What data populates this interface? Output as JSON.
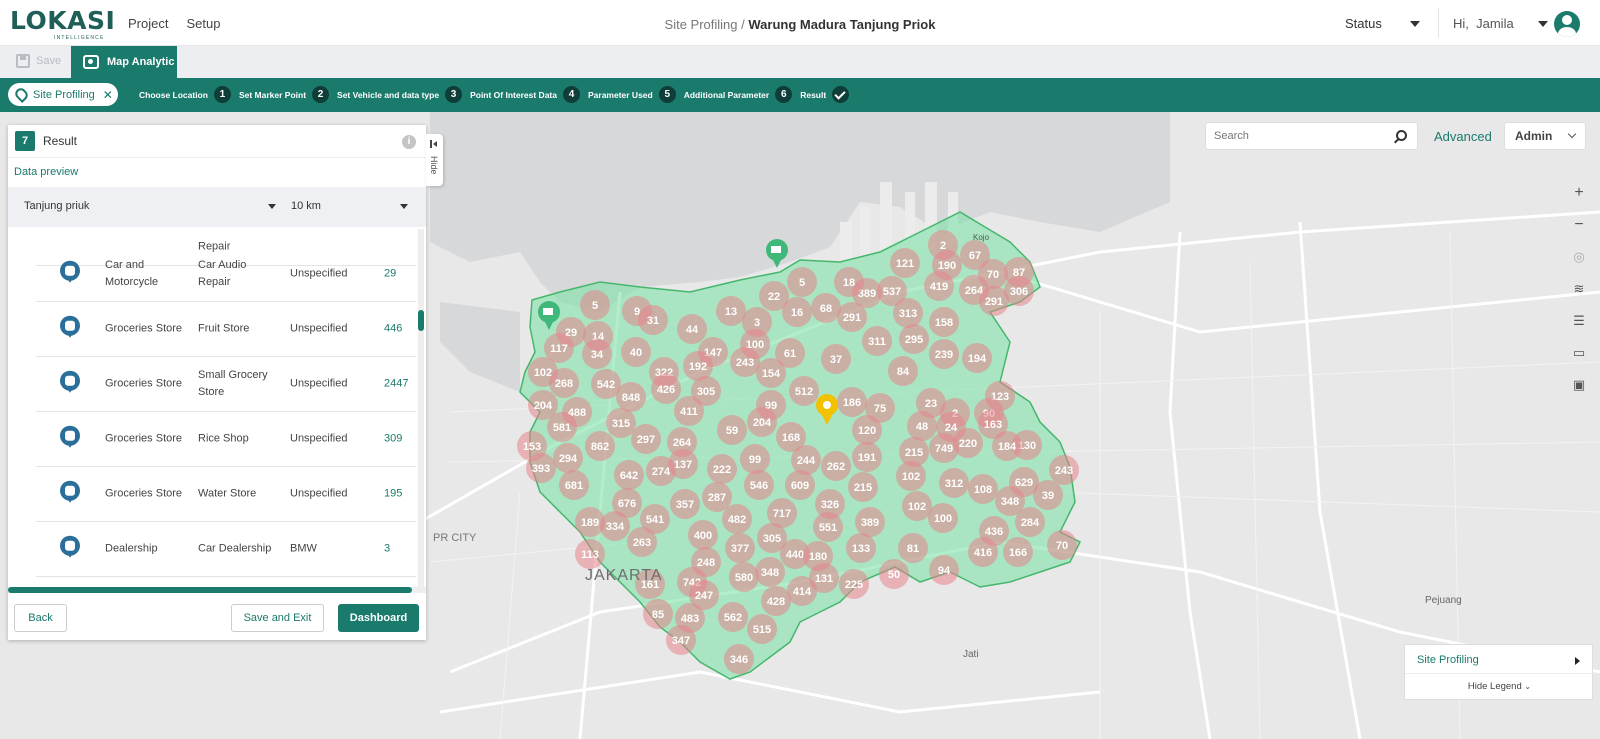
{
  "app": {
    "logo": "LOKASI",
    "logo_sub": "INTELLIGENCE"
  },
  "nav": {
    "project": "Project",
    "setup": "Setup"
  },
  "breadcrumb": {
    "parent": "Site Profiling",
    "separator": "/",
    "current": "Warung Madura Tanjung Priok"
  },
  "header": {
    "status": "Status",
    "greeting": "Hi,",
    "user": "Jamila"
  },
  "toolbar": {
    "save": "Save",
    "map_analytic": "Map Analytic"
  },
  "stepbar": {
    "pill": "Site Profiling",
    "steps": [
      {
        "label": "Choose Location",
        "num": "1"
      },
      {
        "label": "Set Marker Point",
        "num": "2"
      },
      {
        "label": "Set Vehicle and data type",
        "num": "3"
      },
      {
        "label": "Point Of Interest Data",
        "num": "4"
      },
      {
        "label": "Parameter Used",
        "num": "5"
      },
      {
        "label": "Additional Parameter",
        "num": "6"
      },
      {
        "label": "Result",
        "num": ""
      }
    ]
  },
  "panel": {
    "step": "7",
    "title": "Result",
    "info": "i",
    "data_preview": "Data preview",
    "location": "Tanjung priuk",
    "radius": "10 km",
    "partial_row": "Repair",
    "rows": [
      {
        "icon": "car-audio-icon",
        "category": "Car and Motorcycle",
        "sub": "Car Audio Repair",
        "brand": "Unspecified",
        "count": "29"
      },
      {
        "icon": "fruit-icon",
        "category": "Groceries Store",
        "sub": "Fruit Store",
        "brand": "Unspecified",
        "count": "446"
      },
      {
        "icon": "grocery-icon",
        "category": "Groceries Store",
        "sub": "Small Grocery Store",
        "brand": "Unspecified",
        "count": "2447"
      },
      {
        "icon": "rice-icon",
        "category": "Groceries Store",
        "sub": "Rice Shop",
        "brand": "Unspecified",
        "count": "309"
      },
      {
        "icon": "water-icon",
        "category": "Groceries Store",
        "sub": "Water Store",
        "brand": "Unspecified",
        "count": "195"
      },
      {
        "icon": "car-dealer-icon",
        "category": "Dealership",
        "sub": "Car Dealership",
        "brand": "BMW",
        "count": "3"
      }
    ],
    "back": "Back",
    "save_exit": "Save and Exit",
    "dashboard": "Dashboard",
    "hide": "Hide"
  },
  "search": {
    "placeholder": "Search"
  },
  "advanced": "Advanced",
  "role": "Admin",
  "legend": {
    "title": "Site Profiling",
    "hide": "Hide Legend"
  },
  "map": {
    "labels": [
      "JAKARTA",
      "PR CITY",
      "Pejuang",
      "Jati",
      "Kojo"
    ],
    "clusters": [
      "2",
      "190",
      "67",
      "70",
      "87",
      "121",
      "389",
      "537",
      "419",
      "264",
      "306",
      "291",
      "18",
      "5",
      "22",
      "68",
      "291",
      "313",
      "158",
      "9",
      "31",
      "44",
      "13",
      "3",
      "16",
      "5",
      "29",
      "14",
      "117",
      "34",
      "40",
      "100",
      "147",
      "243",
      "61",
      "37",
      "311",
      "295",
      "239",
      "194",
      "192",
      "322",
      "102",
      "268",
      "542",
      "426",
      "305",
      "154",
      "84",
      "204",
      "488",
      "848",
      "411",
      "99",
      "512",
      "186",
      "75",
      "23",
      "2",
      "123",
      "90",
      "581",
      "315",
      "204",
      "168",
      "120",
      "48",
      "24",
      "163",
      "153",
      "862",
      "297",
      "264",
      "59",
      "130",
      "220",
      "184",
      "243",
      "393",
      "294",
      "137",
      "99",
      "244",
      "262",
      "191",
      "215",
      "749",
      "642",
      "274",
      "222",
      "546",
      "609",
      "215",
      "102",
      "312",
      "108",
      "629",
      "39",
      "681",
      "676",
      "357",
      "287",
      "326",
      "348",
      "189",
      "334",
      "541",
      "482",
      "717",
      "551",
      "389",
      "102",
      "100",
      "284",
      "263",
      "400",
      "305",
      "377",
      "440",
      "133",
      "436",
      "161",
      "248",
      "180",
      "81",
      "416",
      "166",
      "70",
      "113",
      "742",
      "580",
      "348",
      "131",
      "225",
      "50",
      "94",
      "85",
      "483",
      "247",
      "428",
      "414",
      "562",
      "515",
      "347",
      "346"
    ]
  }
}
